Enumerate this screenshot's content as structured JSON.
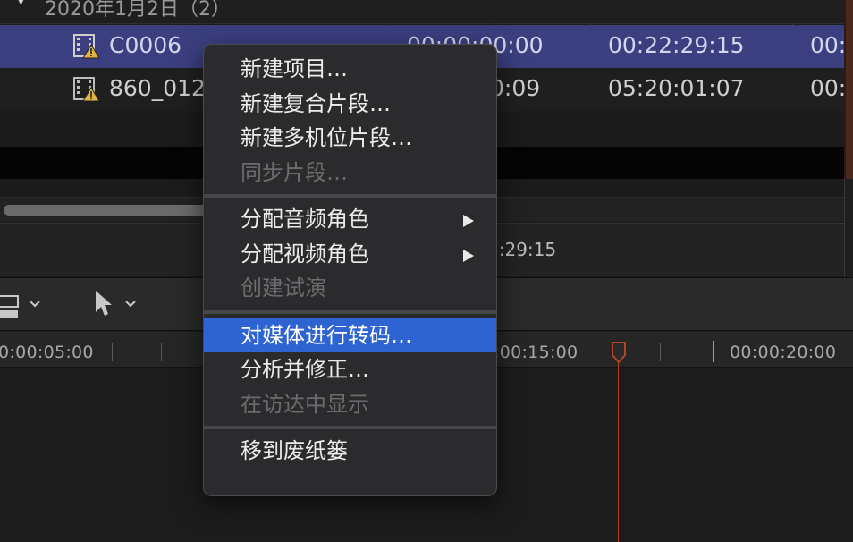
{
  "browser": {
    "group_title": "2020年1月2日（2）",
    "clips": [
      {
        "name": "C0006",
        "start": "00:00:00:00",
        "end": "00:22:29:15",
        "duration": "00:"
      },
      {
        "name": "860_012",
        "start": "0:09",
        "end": "05:20:01:07",
        "duration": "00:"
      }
    ],
    "selected_duration": "2:29:15"
  },
  "timeline": {
    "ruler_labels": [
      "0:00:05:00",
      ":00:15:00",
      "00:00:20:00"
    ],
    "playhead_color": "#b0452a"
  },
  "context_menu": {
    "groups": [
      [
        {
          "label": "新建项目…",
          "enabled": true
        },
        {
          "label": "新建复合片段…",
          "enabled": true
        },
        {
          "label": "新建多机位片段…",
          "enabled": true
        },
        {
          "label": "同步片段…",
          "enabled": false
        }
      ],
      [
        {
          "label": "分配音频角色",
          "enabled": true,
          "submenu": true
        },
        {
          "label": "分配视频角色",
          "enabled": true,
          "submenu": true
        },
        {
          "label": "创建试演",
          "enabled": false
        }
      ],
      [
        {
          "label": "对媒体进行转码…",
          "enabled": true,
          "highlighted": true
        },
        {
          "label": "分析并修正…",
          "enabled": true
        },
        {
          "label": "在访达中显示",
          "enabled": false
        }
      ],
      [
        {
          "label": "移到废纸篓",
          "enabled": true
        }
      ]
    ]
  },
  "colors": {
    "selected_row": "#3b3f80",
    "menu_highlight": "#2d64d2",
    "warning": "#e3b341"
  },
  "icons": {
    "clip_warning": "film-clip-warning-icon",
    "submenu": "chevron-right-icon",
    "select_tool": "arrow-pointer-icon",
    "clip_appearance": "clip-appearance-icon"
  }
}
